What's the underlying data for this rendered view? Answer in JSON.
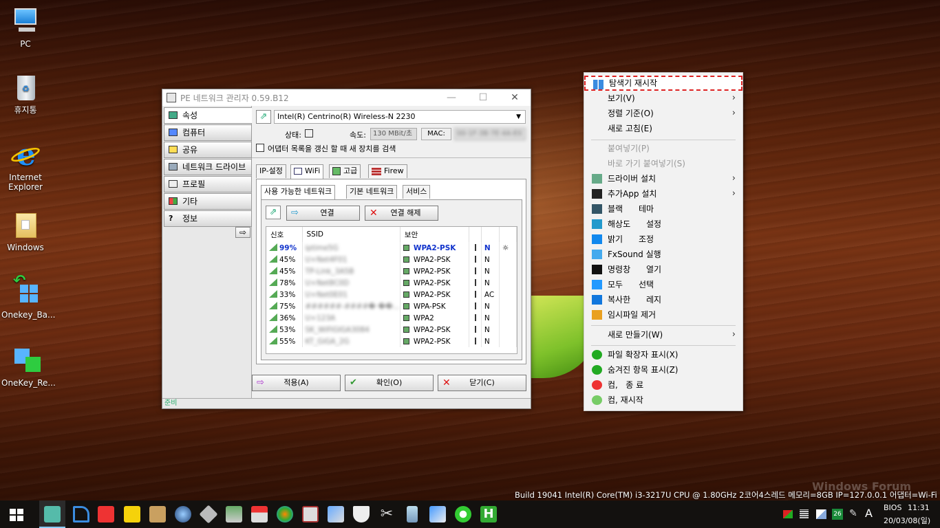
{
  "desktop": {
    "icons": [
      {
        "label": "PC"
      },
      {
        "label": "휴지통"
      },
      {
        "label": "Internet Explorer"
      },
      {
        "label": "Windows"
      },
      {
        "label": "Onekey_Ba..."
      },
      {
        "label": "OneKey_Re..."
      }
    ],
    "build_info": "Build 19041  Intel(R) Core(TM) i3-3217U CPU @ 1.80GHz 2코어4스레드 메모리=8GB IP=127.0.0.1 어댑터=Wi-Fi",
    "watermark": "Windows Forum"
  },
  "window": {
    "title": "PE 네트워크 관리자 0.59.B12",
    "controls": {
      "minimize": "—",
      "maximize": "☐",
      "close": "✕"
    },
    "nav": [
      {
        "label": "속성"
      },
      {
        "label": "컴퓨터"
      },
      {
        "label": "공유"
      },
      {
        "label": "네트워크 드라이브"
      },
      {
        "label": "프로필"
      },
      {
        "label": "기타"
      },
      {
        "label": "정보"
      }
    ],
    "adapter": "Intel(R) Centrino(R) Wireless-N 2230",
    "status_label": "상태:",
    "speed_label": "속도:",
    "speed_value": "130 MBit/초",
    "mac_label": "MAC:",
    "mac_value": "00-1F-3B-7E-4A-E0",
    "refresh_checkbox": "어댑터 목록을 갱신 할 때 새 장치를 검색",
    "tabs": [
      {
        "label": "IP-설정"
      },
      {
        "label": "WiFi"
      },
      {
        "label": "고급"
      },
      {
        "label": "Firew"
      }
    ],
    "subtabs": [
      {
        "label": "사용 가능한 네트워크"
      },
      {
        "label": "기본 네트워크"
      },
      {
        "label": "서비스"
      }
    ],
    "connect": "연결",
    "disconnect": "연결 해제",
    "columns": [
      "신호",
      "SSID",
      "보안",
      "",
      "",
      ""
    ],
    "networks": [
      {
        "signal": "99%",
        "ssid": "iptime5G",
        "security": "WPA2-PSK",
        "mode": "N",
        "extra": "☼"
      },
      {
        "signal": "45%",
        "ssid": "U+Net4F01",
        "security": "WPA2-PSK",
        "mode": "N",
        "extra": ""
      },
      {
        "signal": "45%",
        "ssid": "TP-Link_3A5B",
        "security": "WPA2-PSK",
        "mode": "N",
        "extra": ""
      },
      {
        "signal": "78%",
        "ssid": "U+Net8C0D",
        "security": "WPA2-PSK",
        "mode": "N",
        "extra": ""
      },
      {
        "signal": "33%",
        "ssid": "U+Net0E01",
        "security": "WPA2-PSK",
        "mode": "AC",
        "extra": ""
      },
      {
        "signal": "75%",
        "ssid": "######-####� ��...",
        "security": "WPA-PSK",
        "mode": "N",
        "extra": ""
      },
      {
        "signal": "36%",
        "ssid": "U+123A",
        "security": "WPA2",
        "mode": "N",
        "extra": ""
      },
      {
        "signal": "53%",
        "ssid": "SK_WiFiGIGA3084",
        "security": "WPA2-PSK",
        "mode": "N",
        "extra": ""
      },
      {
        "signal": "55%",
        "ssid": "KT_GiGA_2G",
        "security": "WPA2-PSK",
        "mode": "N",
        "extra": ""
      }
    ],
    "apply": "적용(A)",
    "ok": "확인(O)",
    "close_btn": "닫기(C)",
    "statusbar": "준비"
  },
  "context_menu": {
    "items": [
      {
        "label": "탐색기 재시작"
      },
      {
        "label": "보기(V)"
      },
      {
        "label": "정렬 기준(O)"
      },
      {
        "label": "새로 고침(E)"
      },
      {
        "label": "붙여넣기(P)"
      },
      {
        "label": "바로 가기 붙여넣기(S)"
      },
      {
        "label": "드라이버 설치"
      },
      {
        "label": "추가App 설치"
      },
      {
        "label": "블랙      테마"
      },
      {
        "label": "해상도      설정"
      },
      {
        "label": "밝기      조정"
      },
      {
        "label": "FxSound 실행"
      },
      {
        "label": "명령창      열기"
      },
      {
        "label": "모두      선택"
      },
      {
        "label": "복사한      레지"
      },
      {
        "label": "임시파일 제거"
      },
      {
        "label": "새로 만들기(W)"
      },
      {
        "label": "파일 확장자 표시(X)"
      },
      {
        "label": "숨겨진 항목 표시(Z)"
      },
      {
        "label": "컴,   종 료"
      },
      {
        "label": "컴, 재시작"
      }
    ]
  },
  "taskbar": {
    "tray_badge": "26",
    "ime": "A",
    "bios": "BIOS",
    "time": "11:31",
    "date": "20/03/08(일)"
  }
}
